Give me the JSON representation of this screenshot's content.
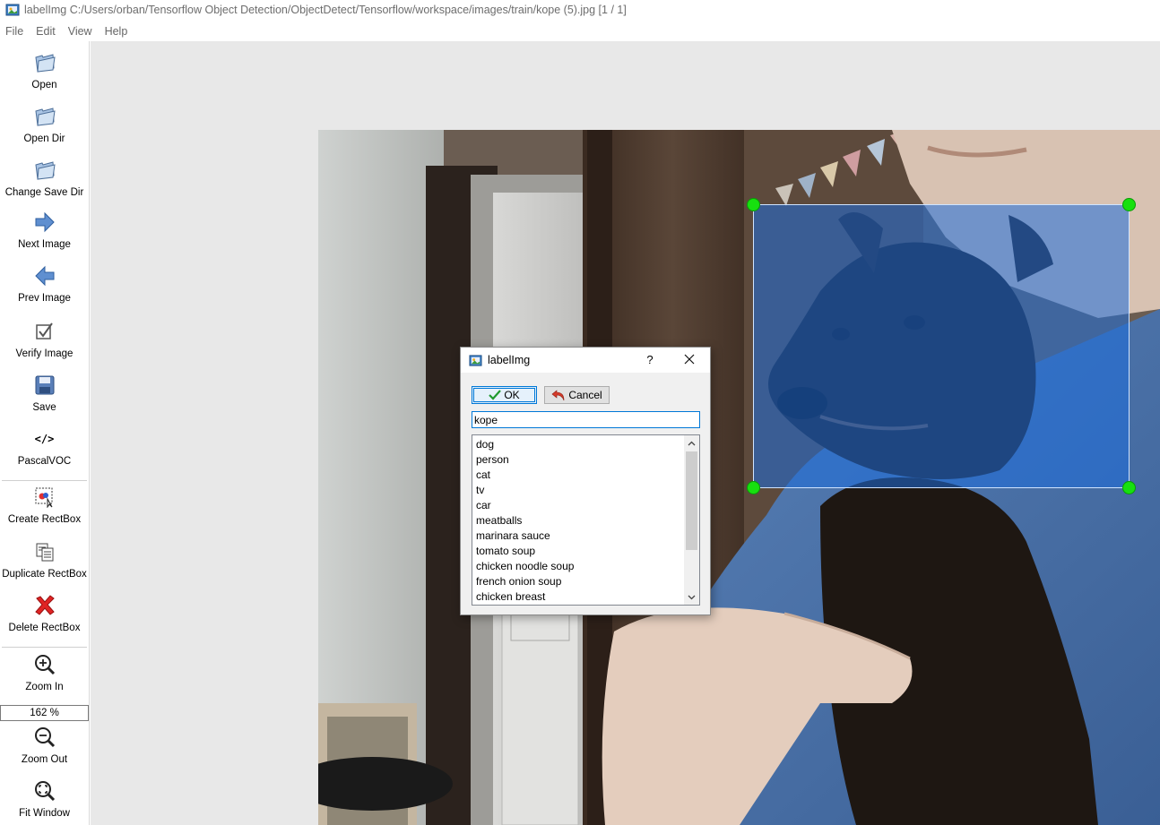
{
  "window": {
    "title": "labelImg C:/Users/orban/Tensorflow Object Detection/ObjectDetect/Tensorflow/workspace/images/train/kope (5).jpg [1 / 1]"
  },
  "menu": {
    "items": [
      "File",
      "Edit",
      "View",
      "Help"
    ]
  },
  "toolbar": {
    "open": "Open",
    "open_dir": "Open Dir",
    "change_save_dir": "Change Save Dir",
    "next_image": "Next Image",
    "prev_image": "Prev Image",
    "verify_image": "Verify Image",
    "save": "Save",
    "format": "PascalVOC",
    "format_icon_text": "</>",
    "create_rectbox": "Create RectBox",
    "duplicate_rectbox": "Duplicate RectBox",
    "delete_rectbox": "Delete RectBox",
    "zoom_in": "Zoom In",
    "zoom_level": "162 %",
    "zoom_out": "Zoom Out",
    "fit_window": "Fit Window"
  },
  "dialog": {
    "title": "labelImg",
    "help": "?",
    "ok": "OK",
    "cancel": "Cancel",
    "input_value": "kope",
    "labels": [
      "dog",
      "person",
      "cat",
      "tv",
      "car",
      "meatballs",
      "marinara sauce",
      "tomato soup",
      "chicken noodle soup",
      "french onion soup",
      "chicken breast"
    ]
  },
  "colors": {
    "bbox_fill": "#1e6edc",
    "handle": "#17e00f",
    "canvas_bg": "#e8e8e8",
    "accent": "#0078d7"
  }
}
